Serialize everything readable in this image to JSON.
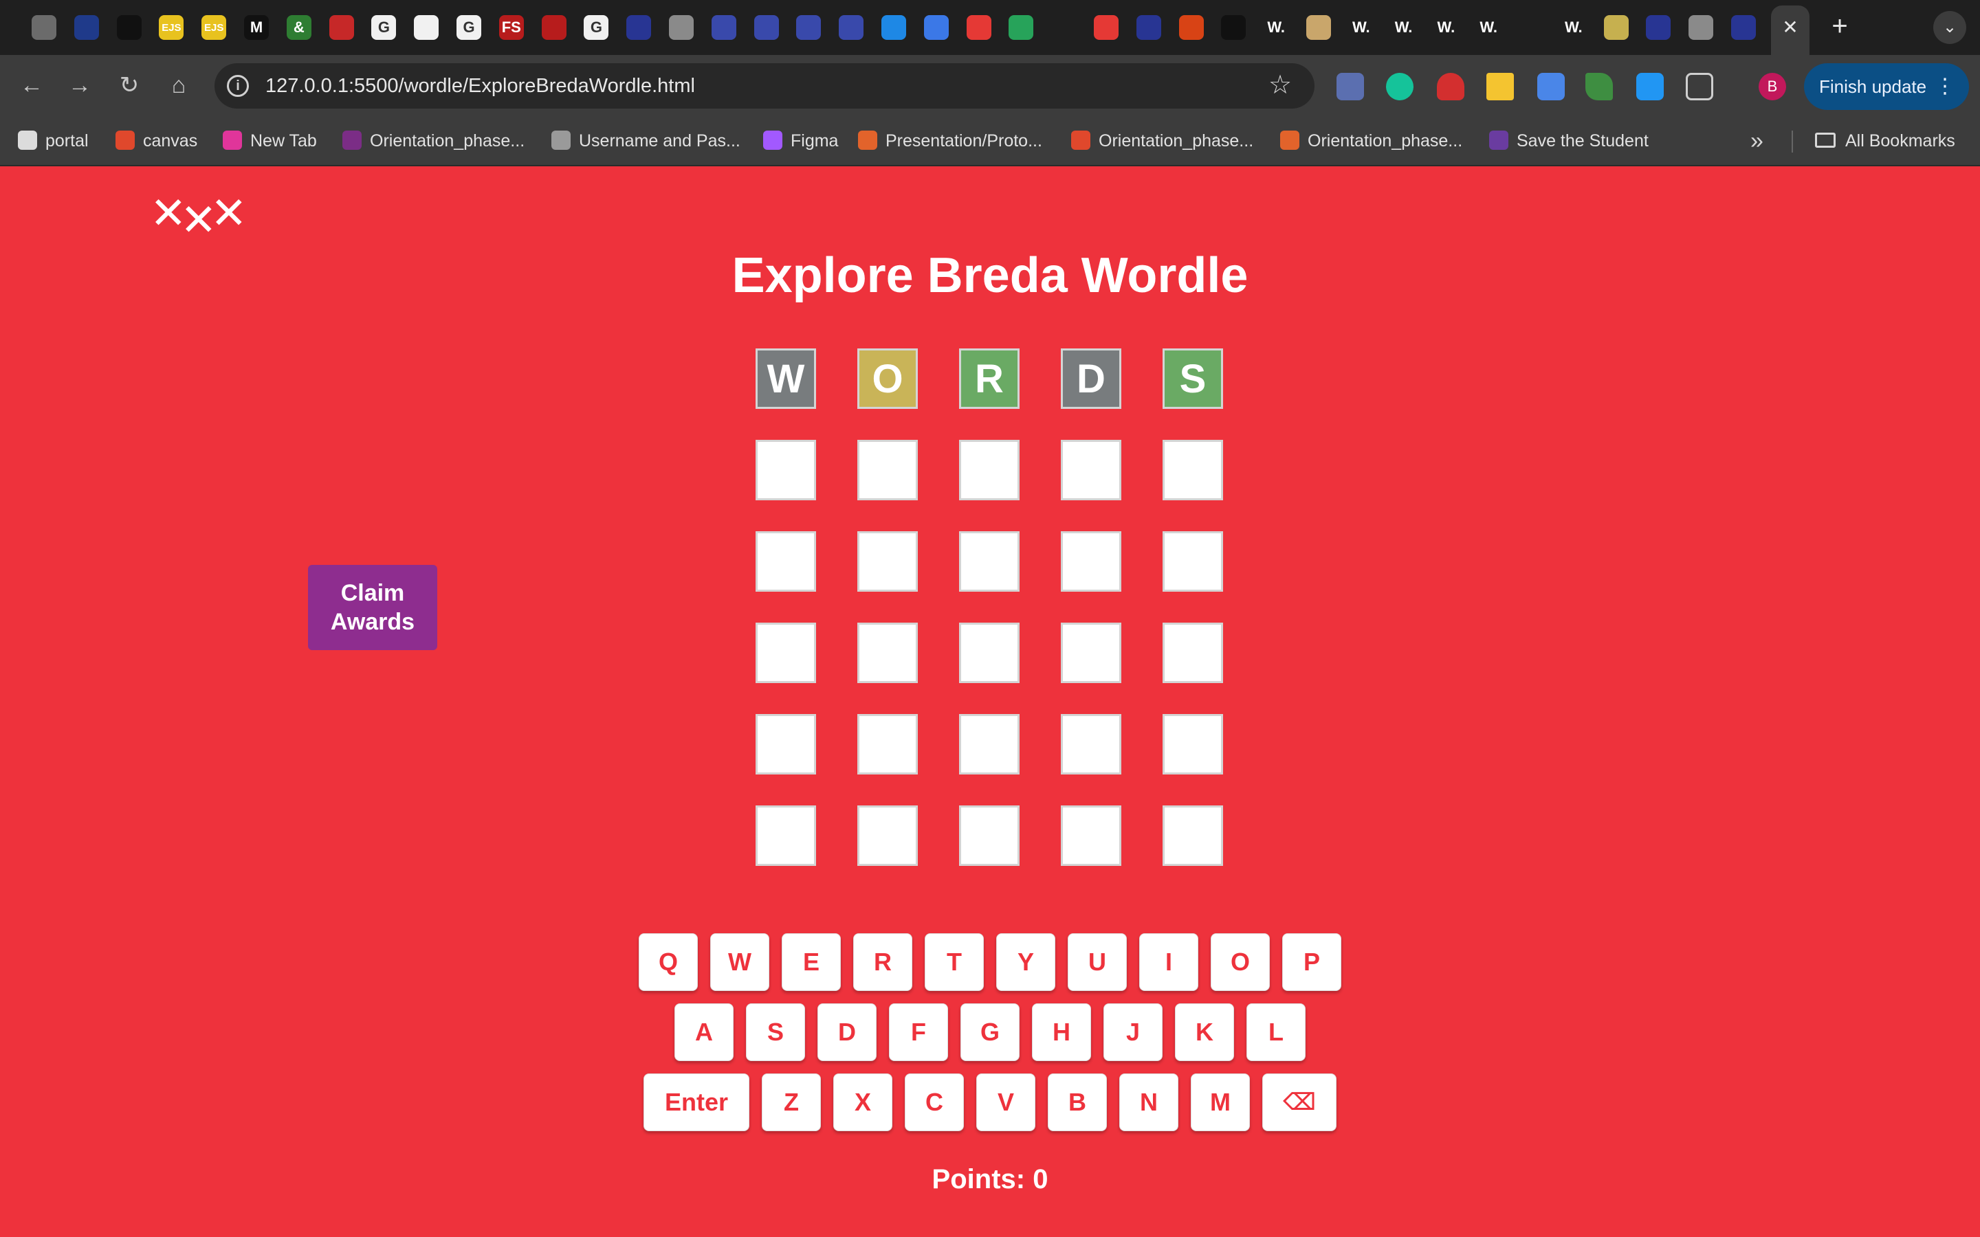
{
  "browser": {
    "url": "127.0.0.1:5500/wordle/ExploreBredaWordle.html",
    "update_label": "Finish update",
    "profile_initial": "B",
    "bookmarks": [
      {
        "label": "portal",
        "color": "#dcdcdc"
      },
      {
        "label": "canvas",
        "color": "#e0482c"
      },
      {
        "label": "New Tab",
        "color": "#e0359a"
      },
      {
        "label": "Orientation_phase...",
        "color": "#7b2d86"
      },
      {
        "label": "Username and Pas...",
        "color": "#9a9a9a"
      },
      {
        "label": "Figma",
        "color": "#a259ff"
      },
      {
        "label": "Presentation/Proto...",
        "color": "#e2632b"
      },
      {
        "label": "Orientation_phase...",
        "color": "#e0482c"
      },
      {
        "label": "Orientation_phase...",
        "color": "#e2632b"
      },
      {
        "label": "Save the Student",
        "color": "#6a3ca0"
      }
    ],
    "all_bookmarks_label": "All Bookmarks",
    "tab_glyphs": [
      "",
      "",
      "",
      "EJS",
      "EJS",
      "M",
      "&",
      "",
      "G",
      "",
      "G",
      "FS",
      "",
      "G",
      "",
      "",
      "",
      "",
      "",
      "",
      "",
      "",
      "",
      "",
      "",
      "",
      "",
      "",
      "",
      "W.",
      "",
      "W.",
      "W.",
      "W.",
      "W.",
      "",
      "W.",
      "",
      "",
      "",
      ""
    ]
  },
  "page": {
    "logo": "XXX",
    "title": "Explore Breda Wordle",
    "claim_line1": "Claim",
    "claim_line2": "Awards",
    "points_label": "Points: 0"
  },
  "board": {
    "colors": {
      "absent": "#787c7e",
      "present": "#c9b458",
      "correct": "#6aaa64"
    },
    "rows": [
      [
        {
          "letter": "W",
          "state": "absent"
        },
        {
          "letter": "O",
          "state": "present"
        },
        {
          "letter": "R",
          "state": "correct"
        },
        {
          "letter": "D",
          "state": "absent"
        },
        {
          "letter": "S",
          "state": "correct"
        }
      ],
      [
        {
          "letter": "",
          "state": "empty"
        },
        {
          "letter": "",
          "state": "empty"
        },
        {
          "letter": "",
          "state": "empty"
        },
        {
          "letter": "",
          "state": "empty"
        },
        {
          "letter": "",
          "state": "empty"
        }
      ],
      [
        {
          "letter": "",
          "state": "empty"
        },
        {
          "letter": "",
          "state": "empty"
        },
        {
          "letter": "",
          "state": "empty"
        },
        {
          "letter": "",
          "state": "empty"
        },
        {
          "letter": "",
          "state": "empty"
        }
      ],
      [
        {
          "letter": "",
          "state": "empty"
        },
        {
          "letter": "",
          "state": "empty"
        },
        {
          "letter": "",
          "state": "empty"
        },
        {
          "letter": "",
          "state": "empty"
        },
        {
          "letter": "",
          "state": "empty"
        }
      ],
      [
        {
          "letter": "",
          "state": "empty"
        },
        {
          "letter": "",
          "state": "empty"
        },
        {
          "letter": "",
          "state": "empty"
        },
        {
          "letter": "",
          "state": "empty"
        },
        {
          "letter": "",
          "state": "empty"
        }
      ],
      [
        {
          "letter": "",
          "state": "empty"
        },
        {
          "letter": "",
          "state": "empty"
        },
        {
          "letter": "",
          "state": "empty"
        },
        {
          "letter": "",
          "state": "empty"
        },
        {
          "letter": "",
          "state": "empty"
        }
      ]
    ]
  },
  "keyboard": {
    "row1": [
      "Q",
      "W",
      "E",
      "R",
      "T",
      "Y",
      "U",
      "I",
      "O",
      "P"
    ],
    "row2": [
      "A",
      "S",
      "D",
      "F",
      "G",
      "H",
      "J",
      "K",
      "L"
    ],
    "row3": [
      "Enter",
      "Z",
      "X",
      "C",
      "V",
      "B",
      "N",
      "M",
      "⌫"
    ]
  }
}
